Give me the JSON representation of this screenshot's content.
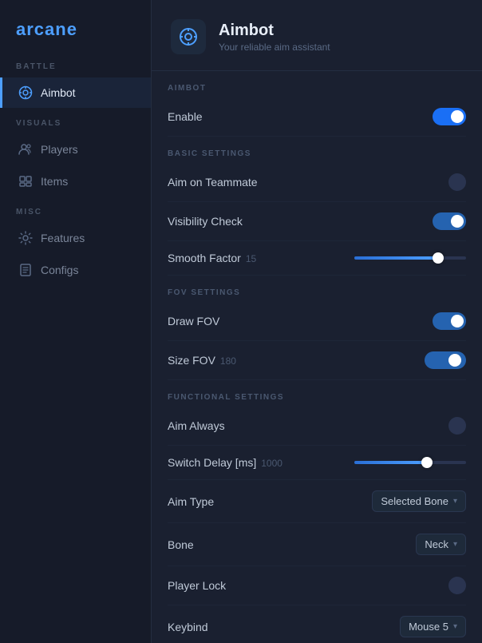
{
  "app": {
    "logo": "arcane"
  },
  "sidebar": {
    "battle_label": "BATTLE",
    "visuals_label": "VISUALS",
    "misc_label": "MISC",
    "items": [
      {
        "id": "aimbot",
        "label": "Aimbot",
        "active": true
      },
      {
        "id": "players",
        "label": "Players",
        "active": false
      },
      {
        "id": "items",
        "label": "Items",
        "active": false
      },
      {
        "id": "features",
        "label": "Features",
        "active": false
      },
      {
        "id": "configs",
        "label": "Configs",
        "active": false
      }
    ]
  },
  "page": {
    "title": "Aimbot",
    "subtitle": "Your reliable aim assistant",
    "section_label": "Aimbot"
  },
  "groups": {
    "aimbot": {
      "label": "Aimbot",
      "enable_label": "Enable",
      "enable_on": true
    },
    "basic": {
      "label": "Basic Settings",
      "aim_on_teammate_label": "Aim on Teammate",
      "aim_on_teammate_on": false,
      "visibility_check_label": "Visibility Check",
      "visibility_check_on": true,
      "smooth_factor_label": "Smooth Factor",
      "smooth_factor_value": "15",
      "smooth_factor_fill": "75"
    },
    "fov": {
      "label": "FOV Settings",
      "draw_fov_label": "Draw FOV",
      "draw_fov_on": true,
      "size_fov_label": "Size FOV",
      "size_fov_value": "180",
      "size_fov_on": true
    },
    "functional": {
      "label": "Functional Settings",
      "aim_always_label": "Aim Always",
      "aim_always_on": false,
      "switch_delay_label": "Switch Delay [ms]",
      "switch_delay_value": "1000",
      "switch_delay_fill": "65",
      "aim_type_label": "Aim Type",
      "aim_type_value": "Selected Bone",
      "bone_label": "Bone",
      "bone_value": "Neck",
      "player_lock_label": "Player Lock",
      "player_lock_on": false,
      "keybind_label": "Keybind",
      "keybind_value": "Mouse 5"
    }
  }
}
